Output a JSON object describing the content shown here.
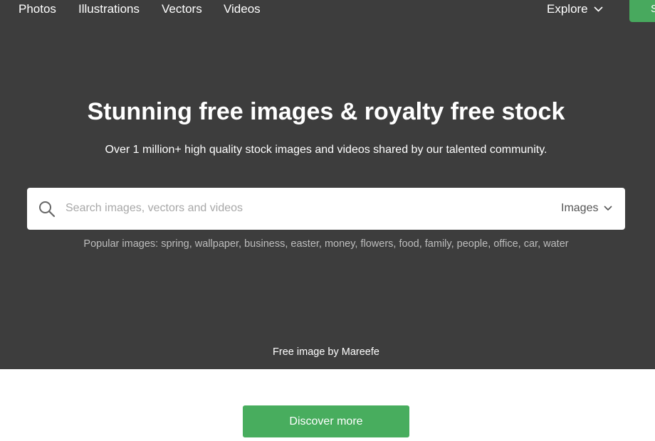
{
  "nav": {
    "links": [
      "Photos",
      "Illustrations",
      "Vectors",
      "Videos"
    ],
    "explore_label": "Explore",
    "submit_button_label": "S"
  },
  "hero": {
    "title": "Stunning free images & royalty free stock",
    "subtitle": "Over 1 million+ high quality stock images and videos shared by our talented community.",
    "background_color": "#3d3d3d",
    "credit": "Free image by Mareefe"
  },
  "search": {
    "placeholder": "Search images, vectors and videos",
    "value": "",
    "type_selected": "Images"
  },
  "popular": {
    "prefix": "Popular images:",
    "keywords": [
      "spring",
      "wallpaper",
      "business",
      "easter",
      "money",
      "flowers",
      "food",
      "family",
      "people",
      "office",
      "car",
      "water"
    ]
  },
  "discover": {
    "label": "Discover more"
  },
  "colors": {
    "accent_green": "#48ad5e"
  },
  "icons": {
    "search": "search-icon",
    "explore_chevron": "chevron-down-icon",
    "type_chevron": "chevron-down-icon"
  }
}
